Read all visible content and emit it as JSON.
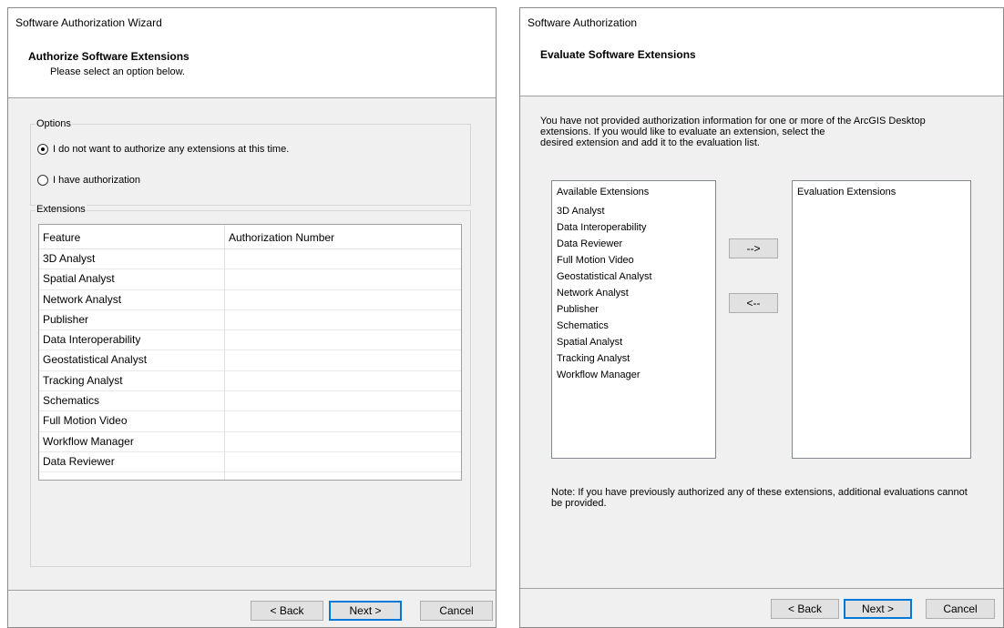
{
  "left": {
    "title": "Software Authorization Wizard",
    "header_title": "Authorize Software Extensions",
    "header_subtitle": "Please select an option below.",
    "options_label": "Options",
    "option1": "I do not want to authorize any extensions at this time.",
    "option2": "I have authorization",
    "extensions_label": "Extensions",
    "table_headers": [
      "Feature",
      "Authorization Number"
    ],
    "rows": [
      "3D Analyst",
      "Spatial Analyst",
      "Network Analyst",
      "Publisher",
      "Data Interoperability",
      "Geostatistical Analyst",
      "Tracking Analyst",
      "Schematics",
      "Full Motion Video",
      "Workflow Manager",
      "Data Reviewer"
    ],
    "back": "< Back",
    "next": "Next >",
    "cancel": "Cancel"
  },
  "right": {
    "title": "Software Authorization",
    "header_title": "Evaluate Software Extensions",
    "desc_line1": "You have not provided authorization information for one or more of the ArcGIS Desktop",
    "desc_line2": "extensions.  If you would like to evaluate an extension, select the",
    "desc_line3": "desired extension and add it to the evaluation list.",
    "available_label": "Available Extensions",
    "available": [
      "3D Analyst",
      "Data Interoperability",
      "Data Reviewer",
      "Full Motion Video",
      "Geostatistical Analyst",
      "Network Analyst",
      "Publisher",
      "Schematics",
      "Spatial Analyst",
      "Tracking Analyst",
      "Workflow Manager"
    ],
    "arrow_right": "-->",
    "arrow_left": "<--",
    "evaluation_label": "Evaluation Extensions",
    "note_line1": "Note:  If you have previously authorized any of these extensions, additional evaluations cannot",
    "note_line2": "be provided.",
    "back": "< Back",
    "next": "Next >",
    "cancel": "Cancel"
  }
}
